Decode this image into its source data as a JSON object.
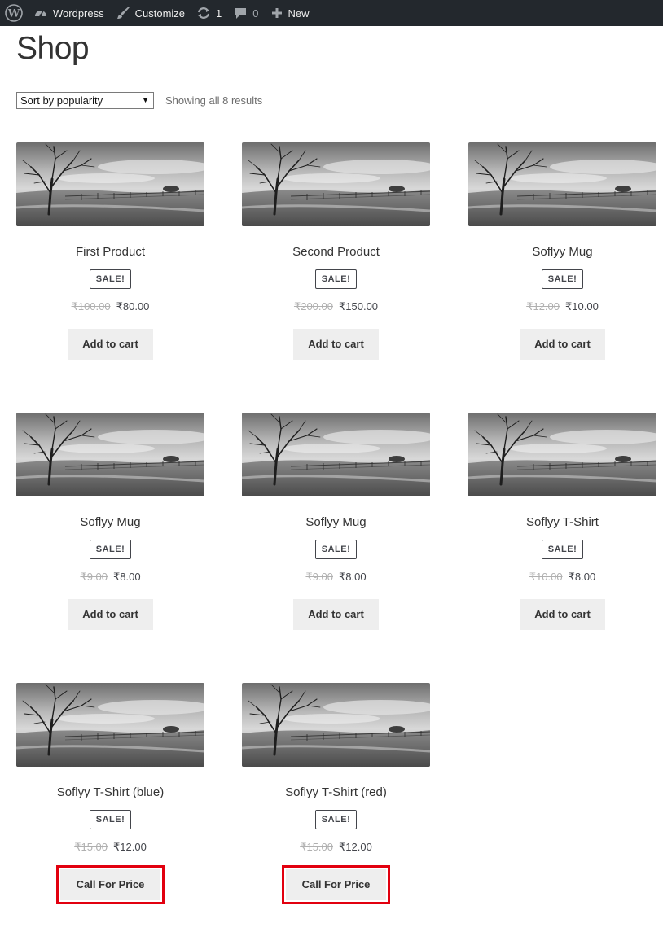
{
  "admin_bar": {
    "site_name": "Wordpress",
    "customize": "Customize",
    "updates_count": "1",
    "comments_count": "0",
    "new_label": "New"
  },
  "shop": {
    "title": "Shop",
    "sort_selected": "Sort by popularity",
    "result_count": "Showing all 8 results",
    "sale_badge": "SALE!"
  },
  "products": [
    {
      "name": "First Product",
      "old_price": "₹100.00",
      "price": "₹80.00",
      "button": "Add to cart"
    },
    {
      "name": "Second Product",
      "old_price": "₹200.00",
      "price": "₹150.00",
      "button": "Add to cart"
    },
    {
      "name": "Soflyy Mug",
      "old_price": "₹12.00",
      "price": "₹10.00",
      "button": "Add to cart"
    },
    {
      "name": "Soflyy Mug",
      "old_price": "₹9.00",
      "price": "₹8.00",
      "button": "Add to cart"
    },
    {
      "name": "Soflyy Mug",
      "old_price": "₹9.00",
      "price": "₹8.00",
      "button": "Add to cart"
    },
    {
      "name": "Soflyy T-Shirt",
      "old_price": "₹10.00",
      "price": "₹8.00",
      "button": "Add to cart"
    },
    {
      "name": "Soflyy T-Shirt (blue)",
      "old_price": "₹15.00",
      "price": "₹12.00",
      "button": "Call For Price"
    },
    {
      "name": "Soflyy T-Shirt (red)",
      "old_price": "₹15.00",
      "price": "₹12.00",
      "button": "Call For Price"
    }
  ],
  "colors": {
    "admin_bar_bg": "#23282d",
    "button_bg": "#eeeeee",
    "highlight_border": "#e2000f"
  }
}
